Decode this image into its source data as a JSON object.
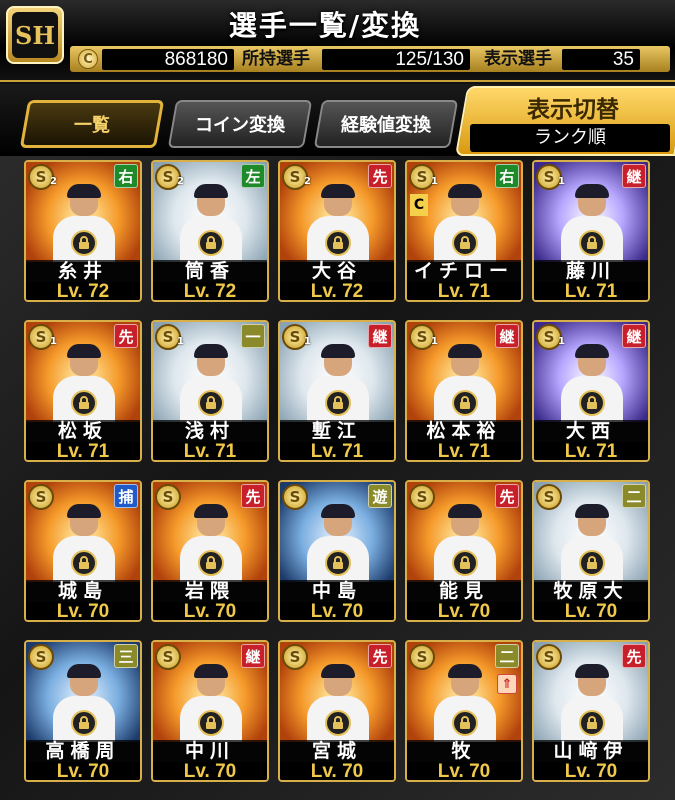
{
  "header": {
    "title": "選手一覧/変換",
    "logo_text": "SH",
    "coin_icon": "coin-icon",
    "coins": "868180",
    "owned_label": "所持選手",
    "owned_value": "125/130",
    "shown_label": "表示選手",
    "shown_value": "35"
  },
  "tabs": [
    {
      "label": "一覧",
      "active": true
    },
    {
      "label": "コイン変換",
      "active": false
    },
    {
      "label": "経験値変換",
      "active": false
    }
  ],
  "display_switch": {
    "title": "表示切替",
    "sort": "ランク順"
  },
  "colors": {
    "accent": "#e2b43c",
    "pos_red": "#c8202a",
    "pos_green": "#1f8a2a",
    "pos_blue": "#1e5ac8",
    "pos_olive": "#8a8a2a"
  },
  "cards": [
    {
      "name": "糸井",
      "level": "Lv. 72",
      "position": "右",
      "pos_color": "#1f8a2a",
      "rank": "2",
      "art": "art-orange"
    },
    {
      "name": "筒香",
      "level": "Lv. 72",
      "position": "左",
      "pos_color": "#1f8a2a",
      "rank": "2",
      "art": "art-light"
    },
    {
      "name": "大谷",
      "level": "Lv. 72",
      "position": "先",
      "pos_color": "#c8202a",
      "rank": "2",
      "art": "art-orange"
    },
    {
      "name": "イチロー",
      "level": "Lv. 71",
      "position": "右",
      "pos_color": "#1f8a2a",
      "rank": "1",
      "art": "art-orange",
      "badge_c": "C"
    },
    {
      "name": "藤川",
      "level": "Lv. 71",
      "position": "継",
      "pos_color": "#c8202a",
      "rank": "1",
      "art": "art-purple"
    },
    {
      "name": "松坂",
      "level": "Lv. 71",
      "position": "先",
      "pos_color": "#c8202a",
      "rank": "1",
      "art": "art-orange"
    },
    {
      "name": "浅村",
      "level": "Lv. 71",
      "position": "一",
      "pos_color": "#8a8a2a",
      "rank": "1",
      "art": "art-light"
    },
    {
      "name": "塹江",
      "level": "Lv. 71",
      "position": "継",
      "pos_color": "#c8202a",
      "rank": "1",
      "art": "art-light"
    },
    {
      "name": "松本裕",
      "level": "Lv. 71",
      "position": "継",
      "pos_color": "#c8202a",
      "rank": "1",
      "art": "art-orange"
    },
    {
      "name": "大西",
      "level": "Lv. 71",
      "position": "継",
      "pos_color": "#c8202a",
      "rank": "1",
      "art": "art-purple"
    },
    {
      "name": "城島",
      "level": "Lv. 70",
      "position": "捕",
      "pos_color": "#1e5ac8",
      "rank": "",
      "art": "art-orange"
    },
    {
      "name": "岩隈",
      "level": "Lv. 70",
      "position": "先",
      "pos_color": "#c8202a",
      "rank": "",
      "art": "art-orange"
    },
    {
      "name": "中島",
      "level": "Lv. 70",
      "position": "遊",
      "pos_color": "#8a8a2a",
      "rank": "",
      "art": "art-blue"
    },
    {
      "name": "能見",
      "level": "Lv. 70",
      "position": "先",
      "pos_color": "#c8202a",
      "rank": "",
      "art": "art-orange"
    },
    {
      "name": "牧原大",
      "level": "Lv. 70",
      "position": "二",
      "pos_color": "#8a8a2a",
      "rank": "",
      "art": "art-light"
    },
    {
      "name": "高橋周",
      "level": "Lv. 70",
      "position": "三",
      "pos_color": "#8a8a2a",
      "rank": "",
      "art": "art-blue"
    },
    {
      "name": "中川",
      "level": "Lv. 70",
      "position": "継",
      "pos_color": "#c8202a",
      "rank": "",
      "art": "art-orange"
    },
    {
      "name": "宮城",
      "level": "Lv. 70",
      "position": "先",
      "pos_color": "#c8202a",
      "rank": "",
      "art": "art-orange"
    },
    {
      "name": "牧",
      "level": "Lv. 70",
      "position": "二",
      "pos_color": "#8a8a2a",
      "rank": "",
      "art": "art-orange",
      "badge_up": "⇑"
    },
    {
      "name": "山﨑伊",
      "level": "Lv. 70",
      "position": "先",
      "pos_color": "#c8202a",
      "rank": "",
      "art": "art-light"
    }
  ]
}
